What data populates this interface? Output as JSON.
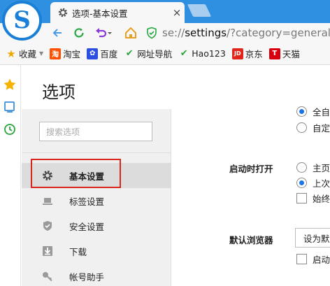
{
  "tab": {
    "title": "选项-基本设置",
    "close": "×"
  },
  "address": {
    "prefix": "se://",
    "bold": "settings",
    "suffix": "/?category=general"
  },
  "bookmarks": [
    {
      "label": "收藏",
      "icon": "star-icon"
    },
    {
      "label": "淘宝",
      "icon": "taobao-icon",
      "badge": "淘"
    },
    {
      "label": "百度",
      "icon": "baidu-icon",
      "badge": "✿"
    },
    {
      "label": "网址导航",
      "icon": "hao-icon",
      "badge": "✔"
    },
    {
      "label": "Hao123",
      "icon": "hao123-icon",
      "badge": "✔"
    },
    {
      "label": "京东",
      "icon": "jd-icon",
      "badge": "JD"
    },
    {
      "label": "天猫",
      "icon": "tmall-icon",
      "badge": "T"
    }
  ],
  "page": {
    "title": "选项"
  },
  "search": {
    "placeholder": "搜索选项"
  },
  "sidebar": [
    {
      "label": "基本设置",
      "icon": "gear-icon"
    },
    {
      "label": "标签设置",
      "icon": "tab-icon"
    },
    {
      "label": "安全设置",
      "icon": "shield-icon"
    },
    {
      "label": "下载",
      "icon": "download-icon"
    },
    {
      "label": "帐号助手",
      "icon": "key-icon"
    }
  ],
  "main": {
    "top_options": [
      "全自",
      "自定"
    ],
    "startup": {
      "label": "启动时打开",
      "options": [
        "主页",
        "上次",
        "始终"
      ]
    },
    "default_browser": {
      "label": "默认浏览器",
      "button": "设为默",
      "option": "启动"
    }
  },
  "colors": {
    "accent": "#2f8fe0",
    "highlight": "#d9261c",
    "radio": "#1a73e8"
  }
}
